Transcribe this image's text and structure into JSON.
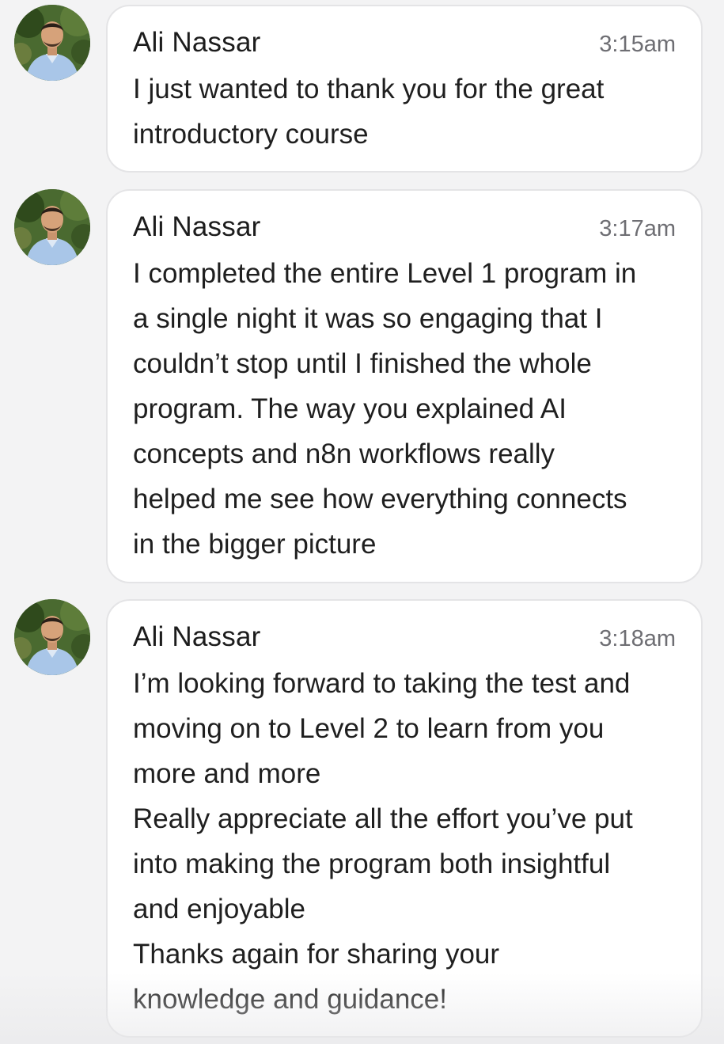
{
  "messages": [
    {
      "sender": "Ali Nassar",
      "time": "3:15am",
      "lines": [
        "I just wanted to thank you for the great",
        "introductory course"
      ]
    },
    {
      "sender": "Ali Nassar",
      "time": "3:17am",
      "lines": [
        "I completed the entire Level 1 program in",
        "a single night it was so engaging that I",
        "couldn’t stop until I finished the whole",
        "program. The way you explained AI",
        "concepts and n8n workflows really",
        "helped me see how everything connects",
        "in the bigger picture"
      ]
    },
    {
      "sender": "Ali Nassar",
      "time": "3:18am",
      "lines": [
        "I’m looking forward to taking the test and",
        "moving on to Level 2 to learn from you",
        "more and more",
        "Really appreciate all the effort you’ve put",
        "into making the program both insightful",
        "and enjoyable",
        "Thanks again for sharing your",
        "knowledge and guidance!"
      ]
    }
  ],
  "colors": {
    "background": "#f3f3f4",
    "bubble": "#ffffff",
    "bubble_border": "#e4e4e6",
    "text": "#1f1f1f",
    "timestamp": "#6e6e73"
  },
  "icons": {
    "avatar": "user-photo-avatar"
  }
}
